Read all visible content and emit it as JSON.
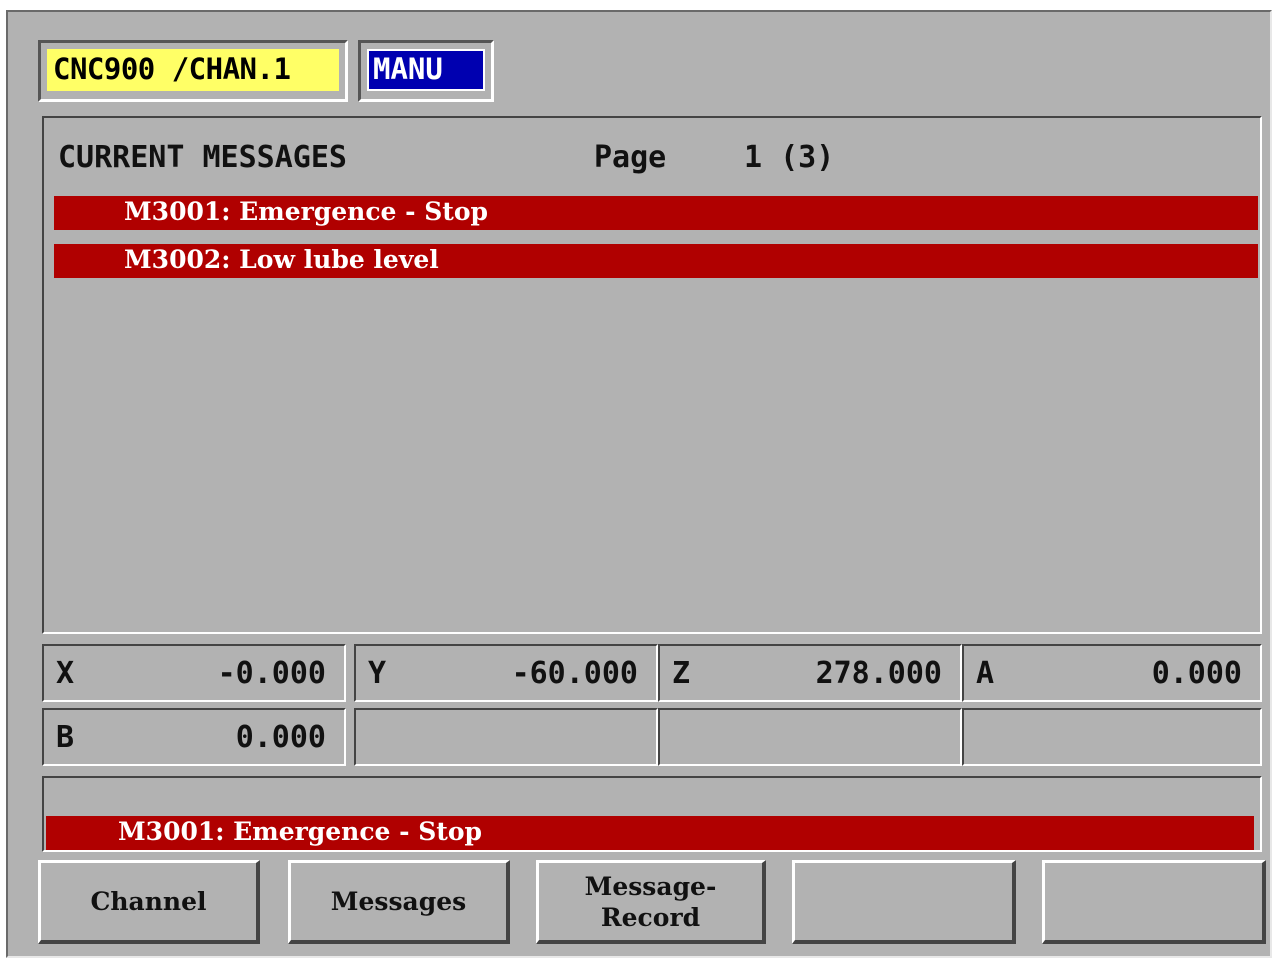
{
  "header": {
    "channel": "CNC900 /CHAN.1",
    "mode": "MANU"
  },
  "messages_panel": {
    "title": "CURRENT MESSAGES",
    "page_label": "Page",
    "page_number": "1 (3)",
    "messages": [
      "M3001: Emergence - Stop",
      "M3002: Low lube level"
    ]
  },
  "axes": [
    {
      "name": "X",
      "value": "-0.000"
    },
    {
      "name": "Y",
      "value": "-60.000"
    },
    {
      "name": "Z",
      "value": "278.000"
    },
    {
      "name": "A",
      "value": "0.000"
    },
    {
      "name": "B",
      "value": "0.000"
    },
    {
      "name": "",
      "value": ""
    },
    {
      "name": "",
      "value": ""
    },
    {
      "name": "",
      "value": ""
    }
  ],
  "status": {
    "message": "M3001: Emergence - Stop"
  },
  "softkeys": [
    {
      "label": "Channel"
    },
    {
      "label": "Messages"
    },
    {
      "label": "Message-\nRecord"
    },
    {
      "label": ""
    },
    {
      "label": ""
    }
  ],
  "colors": {
    "alarm_red": "#b00000",
    "channel_yellow": "#ffff66",
    "mode_blue": "#0000b0",
    "background_gray": "#b2b2b2"
  }
}
